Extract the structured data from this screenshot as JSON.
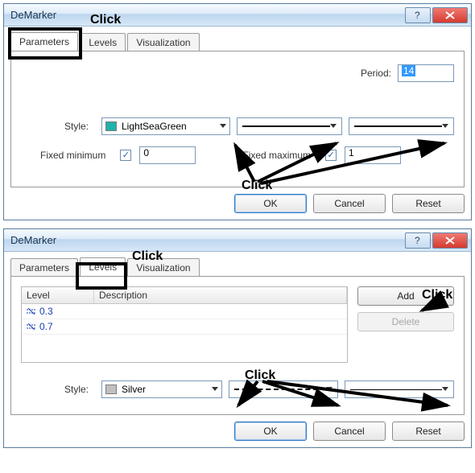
{
  "dialog1": {
    "title": "DeMarker",
    "tabs": {
      "parameters": "Parameters",
      "levels": "Levels",
      "visualization": "Visualization"
    },
    "period_label": "Period:",
    "period_value": "14",
    "style_label": "Style:",
    "color_name": "LightSeaGreen",
    "fixed_min_label": "Fixed minimum",
    "fixed_min_value": "0",
    "fixed_max_label": "Fixed maximum",
    "fixed_max_value": "1",
    "buttons": {
      "ok": "OK",
      "cancel": "Cancel",
      "reset": "Reset"
    }
  },
  "dialog2": {
    "title": "DeMarker",
    "tabs": {
      "parameters": "Parameters",
      "levels": "Levels",
      "visualization": "Visualization"
    },
    "table": {
      "col_level": "Level",
      "col_desc": "Description",
      "rows": [
        {
          "level": "0.3",
          "desc": ""
        },
        {
          "level": "0.7",
          "desc": ""
        }
      ]
    },
    "side_buttons": {
      "add": "Add",
      "delete": "Delete"
    },
    "style_label": "Style:",
    "color_name": "Silver",
    "buttons": {
      "ok": "OK",
      "cancel": "Cancel",
      "reset": "Reset"
    }
  },
  "annotations": {
    "click": "Click"
  }
}
